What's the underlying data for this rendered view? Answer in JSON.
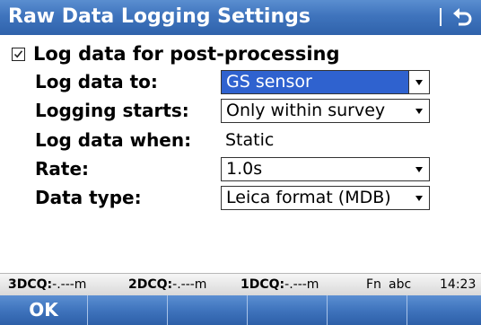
{
  "window": {
    "title": "Raw Data Logging Settings",
    "back_icon": "back-arrow-icon"
  },
  "form": {
    "log_checkbox": {
      "label": "Log data for post-processing",
      "checked": true
    },
    "log_to": {
      "label": "Log data to:",
      "value": "GS sensor"
    },
    "logging_starts": {
      "label": "Logging starts:",
      "value": "Only within survey"
    },
    "log_when": {
      "label": "Log data when:",
      "value": "Static"
    },
    "rate": {
      "label": "Rate:",
      "value": "1.0s"
    },
    "data_type": {
      "label": "Data type:",
      "value": "Leica format (MDB)"
    }
  },
  "status": {
    "cq3d_label": "3DCQ:",
    "cq3d_value": "-.---m",
    "cq2d_label": "2DCQ:",
    "cq2d_value": "-.---m",
    "cq1d_label": "1DCQ:",
    "cq1d_value": "-.---m",
    "fn": "Fn",
    "input_mode": "abc",
    "time": "14:23"
  },
  "softkeys": [
    "OK",
    "",
    "",
    "",
    "",
    ""
  ],
  "colors": {
    "title_bar": "#3f74bd",
    "selection": "#2f62cf"
  }
}
